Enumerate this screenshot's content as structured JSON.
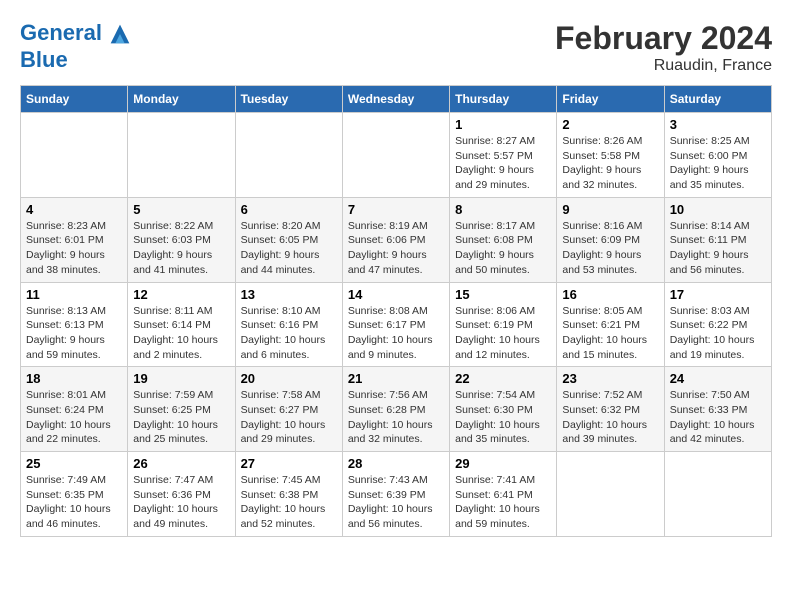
{
  "header": {
    "logo_line1": "General",
    "logo_line2": "Blue",
    "title": "February 2024",
    "subtitle": "Ruaudin, France"
  },
  "days_of_week": [
    "Sunday",
    "Monday",
    "Tuesday",
    "Wednesday",
    "Thursday",
    "Friday",
    "Saturday"
  ],
  "weeks": [
    [
      {
        "day": "",
        "info": ""
      },
      {
        "day": "",
        "info": ""
      },
      {
        "day": "",
        "info": ""
      },
      {
        "day": "",
        "info": ""
      },
      {
        "day": "1",
        "info": "Sunrise: 8:27 AM\nSunset: 5:57 PM\nDaylight: 9 hours\nand 29 minutes."
      },
      {
        "day": "2",
        "info": "Sunrise: 8:26 AM\nSunset: 5:58 PM\nDaylight: 9 hours\nand 32 minutes."
      },
      {
        "day": "3",
        "info": "Sunrise: 8:25 AM\nSunset: 6:00 PM\nDaylight: 9 hours\nand 35 minutes."
      }
    ],
    [
      {
        "day": "4",
        "info": "Sunrise: 8:23 AM\nSunset: 6:01 PM\nDaylight: 9 hours\nand 38 minutes."
      },
      {
        "day": "5",
        "info": "Sunrise: 8:22 AM\nSunset: 6:03 PM\nDaylight: 9 hours\nand 41 minutes."
      },
      {
        "day": "6",
        "info": "Sunrise: 8:20 AM\nSunset: 6:05 PM\nDaylight: 9 hours\nand 44 minutes."
      },
      {
        "day": "7",
        "info": "Sunrise: 8:19 AM\nSunset: 6:06 PM\nDaylight: 9 hours\nand 47 minutes."
      },
      {
        "day": "8",
        "info": "Sunrise: 8:17 AM\nSunset: 6:08 PM\nDaylight: 9 hours\nand 50 minutes."
      },
      {
        "day": "9",
        "info": "Sunrise: 8:16 AM\nSunset: 6:09 PM\nDaylight: 9 hours\nand 53 minutes."
      },
      {
        "day": "10",
        "info": "Sunrise: 8:14 AM\nSunset: 6:11 PM\nDaylight: 9 hours\nand 56 minutes."
      }
    ],
    [
      {
        "day": "11",
        "info": "Sunrise: 8:13 AM\nSunset: 6:13 PM\nDaylight: 9 hours\nand 59 minutes."
      },
      {
        "day": "12",
        "info": "Sunrise: 8:11 AM\nSunset: 6:14 PM\nDaylight: 10 hours\nand 2 minutes."
      },
      {
        "day": "13",
        "info": "Sunrise: 8:10 AM\nSunset: 6:16 PM\nDaylight: 10 hours\nand 6 minutes."
      },
      {
        "day": "14",
        "info": "Sunrise: 8:08 AM\nSunset: 6:17 PM\nDaylight: 10 hours\nand 9 minutes."
      },
      {
        "day": "15",
        "info": "Sunrise: 8:06 AM\nSunset: 6:19 PM\nDaylight: 10 hours\nand 12 minutes."
      },
      {
        "day": "16",
        "info": "Sunrise: 8:05 AM\nSunset: 6:21 PM\nDaylight: 10 hours\nand 15 minutes."
      },
      {
        "day": "17",
        "info": "Sunrise: 8:03 AM\nSunset: 6:22 PM\nDaylight: 10 hours\nand 19 minutes."
      }
    ],
    [
      {
        "day": "18",
        "info": "Sunrise: 8:01 AM\nSunset: 6:24 PM\nDaylight: 10 hours\nand 22 minutes."
      },
      {
        "day": "19",
        "info": "Sunrise: 7:59 AM\nSunset: 6:25 PM\nDaylight: 10 hours\nand 25 minutes."
      },
      {
        "day": "20",
        "info": "Sunrise: 7:58 AM\nSunset: 6:27 PM\nDaylight: 10 hours\nand 29 minutes."
      },
      {
        "day": "21",
        "info": "Sunrise: 7:56 AM\nSunset: 6:28 PM\nDaylight: 10 hours\nand 32 minutes."
      },
      {
        "day": "22",
        "info": "Sunrise: 7:54 AM\nSunset: 6:30 PM\nDaylight: 10 hours\nand 35 minutes."
      },
      {
        "day": "23",
        "info": "Sunrise: 7:52 AM\nSunset: 6:32 PM\nDaylight: 10 hours\nand 39 minutes."
      },
      {
        "day": "24",
        "info": "Sunrise: 7:50 AM\nSunset: 6:33 PM\nDaylight: 10 hours\nand 42 minutes."
      }
    ],
    [
      {
        "day": "25",
        "info": "Sunrise: 7:49 AM\nSunset: 6:35 PM\nDaylight: 10 hours\nand 46 minutes."
      },
      {
        "day": "26",
        "info": "Sunrise: 7:47 AM\nSunset: 6:36 PM\nDaylight: 10 hours\nand 49 minutes."
      },
      {
        "day": "27",
        "info": "Sunrise: 7:45 AM\nSunset: 6:38 PM\nDaylight: 10 hours\nand 52 minutes."
      },
      {
        "day": "28",
        "info": "Sunrise: 7:43 AM\nSunset: 6:39 PM\nDaylight: 10 hours\nand 56 minutes."
      },
      {
        "day": "29",
        "info": "Sunrise: 7:41 AM\nSunset: 6:41 PM\nDaylight: 10 hours\nand 59 minutes."
      },
      {
        "day": "",
        "info": ""
      },
      {
        "day": "",
        "info": ""
      }
    ]
  ]
}
